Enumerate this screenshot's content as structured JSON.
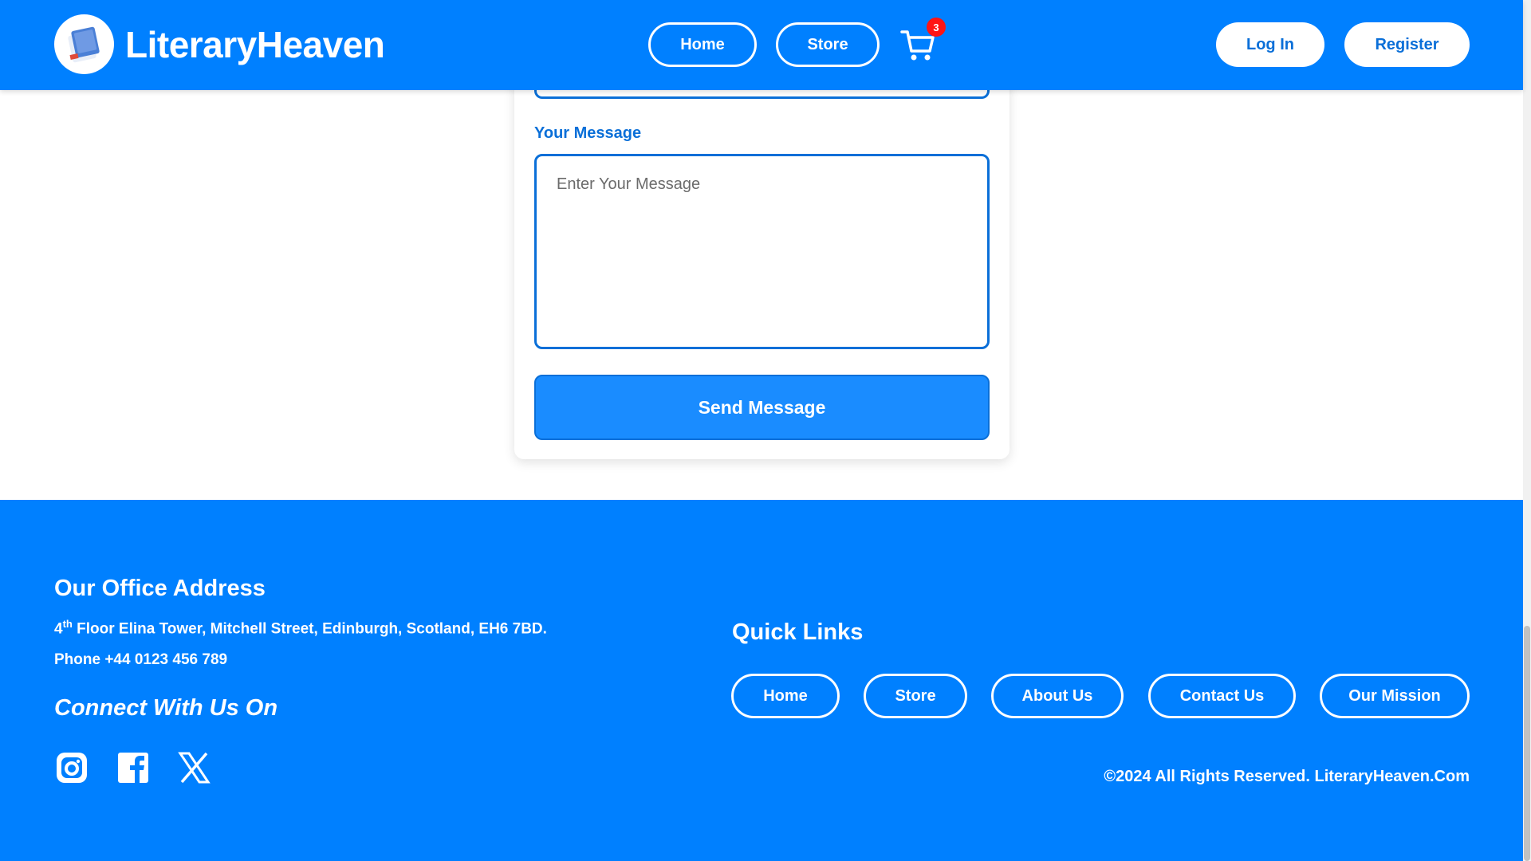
{
  "header": {
    "brand_name": "LiteraryHeaven",
    "nav": {
      "home": "Home",
      "store": "Store"
    },
    "cart_count": "3",
    "login": "Log In",
    "register": "Register"
  },
  "form": {
    "message_label": "Your Message",
    "message_placeholder": "Enter Your Message",
    "send_label": "Send Message"
  },
  "footer": {
    "office_heading": "Our Office Address",
    "address_floor": "4",
    "address_suffix": "th",
    "address_rest": " Floor Elina Tower, Mitchell Street, Edinburgh, Scotland, EH6 7BD.",
    "phone": "Phone +44 0123 456 789",
    "connect_heading": "Connect With Us On",
    "social": [
      "instagram-icon",
      "facebook-icon",
      "x-icon"
    ],
    "quick_links_heading": "Quick Links",
    "quick_links": [
      "Home",
      "Store",
      "About Us",
      "Contact Us",
      "Our Mission"
    ],
    "copyright": "©2024 All Rights Reserved. LiteraryHeaven.Com"
  },
  "colors": {
    "primary": "#0080ff",
    "accent_text": "#0a6fd8",
    "button": "#1a8cff",
    "badge": "#ff1414",
    "white": "#ffffff"
  }
}
